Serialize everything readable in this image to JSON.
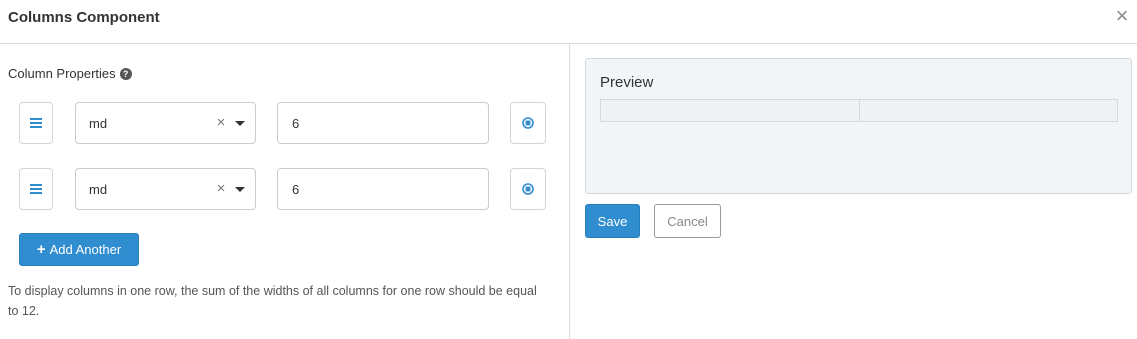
{
  "dialog": {
    "title": "Columns Component",
    "close_glyph": "×"
  },
  "column_properties": {
    "label": "Column Properties",
    "help_glyph": "?",
    "rows": [
      {
        "size": "md",
        "width": "6"
      },
      {
        "size": "md",
        "width": "6"
      }
    ],
    "clear_glyph": "×",
    "add_button_plus": "+",
    "add_button_label": "Add Another",
    "help_text": "To display columns in one row, the sum of the widths of all columns for one row should be equal to 12."
  },
  "preview": {
    "title": "Preview"
  },
  "actions": {
    "save_label": "Save",
    "cancel_label": "Cancel"
  },
  "colors": {
    "primary": "#2f8dd0",
    "preview_bg": "#f1f5f8"
  },
  "icons": {
    "close": "close-icon",
    "help": "help-icon",
    "drag": "drag-handle-icon",
    "remove": "remove-circle-icon",
    "clear": "clear-icon",
    "dropdown": "chevron-down-icon",
    "add": "plus-icon"
  }
}
